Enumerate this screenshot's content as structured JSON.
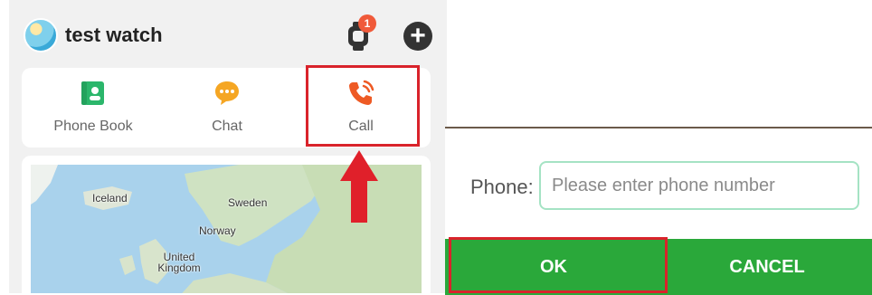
{
  "header": {
    "device_name": "test watch",
    "notification_count": "1"
  },
  "functions": [
    {
      "label": "Phone Book",
      "icon": "phone-book-icon",
      "color": "#2bb66b"
    },
    {
      "label": "Chat",
      "icon": "chat-icon",
      "color": "#f5a623"
    },
    {
      "label": "Call",
      "icon": "call-icon",
      "color": "#ee5a24"
    }
  ],
  "map": {
    "labels": [
      "Iceland",
      "Sweden",
      "Norway",
      "United Kingdom"
    ]
  },
  "dialog": {
    "phone_label": "Phone:",
    "phone_placeholder": "Please enter phone number",
    "ok_label": "OK",
    "cancel_label": "CANCEL"
  },
  "colors": {
    "accent_green": "#2aa83a",
    "highlight_red": "#d9232b",
    "input_border": "#a5e3c4"
  }
}
